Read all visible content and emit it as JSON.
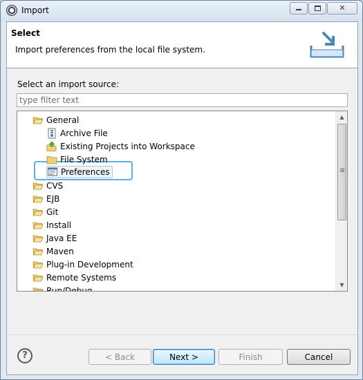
{
  "window": {
    "title": "Import"
  },
  "header": {
    "title": "Select",
    "description": "Import preferences from the local file system."
  },
  "source": {
    "label": "Select an import source:",
    "filter_placeholder": "type filter text",
    "filter_value": ""
  },
  "tree": {
    "items": [
      {
        "label": "General",
        "level": 0,
        "icon": "folder-open-icon"
      },
      {
        "label": "Archive File",
        "level": 1,
        "icon": "archive-file-icon"
      },
      {
        "label": "Existing Projects into Workspace",
        "level": 1,
        "icon": "existing-projects-icon"
      },
      {
        "label": "File System",
        "level": 1,
        "icon": "folder-icon"
      },
      {
        "label": "Preferences",
        "level": 1,
        "icon": "preferences-icon",
        "selected": true
      },
      {
        "label": "CVS",
        "level": 0,
        "icon": "folder-icon"
      },
      {
        "label": "EJB",
        "level": 0,
        "icon": "folder-icon"
      },
      {
        "label": "Git",
        "level": 0,
        "icon": "folder-icon"
      },
      {
        "label": "Install",
        "level": 0,
        "icon": "folder-icon"
      },
      {
        "label": "Java EE",
        "level": 0,
        "icon": "folder-icon"
      },
      {
        "label": "Maven",
        "level": 0,
        "icon": "folder-icon"
      },
      {
        "label": "Plug-in Development",
        "level": 0,
        "icon": "folder-icon"
      },
      {
        "label": "Remote Systems",
        "level": 0,
        "icon": "folder-icon"
      },
      {
        "label": "Run/Debug",
        "level": 0,
        "icon": "folder-icon"
      }
    ]
  },
  "buttons": {
    "help": "?",
    "back": "< Back",
    "next": "Next >",
    "finish": "Finish",
    "cancel": "Cancel"
  },
  "colors": {
    "selection_highlight": "#5ab1e8",
    "folder": "#e8c25a"
  }
}
